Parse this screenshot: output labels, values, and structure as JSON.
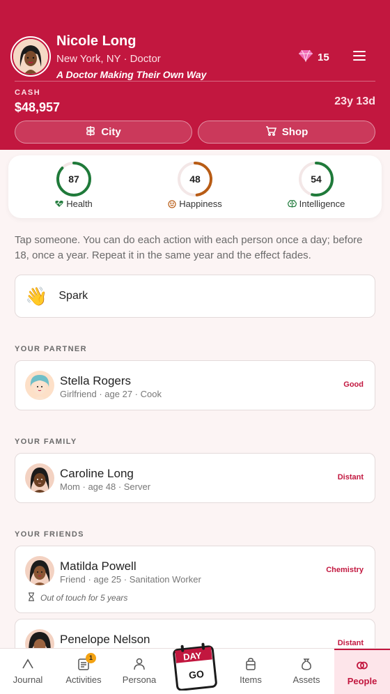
{
  "profile": {
    "name": "Nicole Long",
    "location": "New York, NY · Doctor",
    "tagline": "A Doctor Making Their Own Way",
    "gems": "15",
    "cash_label": "CASH",
    "cash": "$48,957",
    "age": "23y 13d"
  },
  "header_buttons": {
    "city": "City",
    "shop": "Shop"
  },
  "stats": [
    {
      "value": "87",
      "label": "Health",
      "icon": "heartbeat-icon",
      "color": "#1f7a3a"
    },
    {
      "value": "48",
      "label": "Happiness",
      "icon": "smile-icon",
      "color": "#b85c15"
    },
    {
      "value": "54",
      "label": "Intelligence",
      "icon": "brain-icon",
      "color": "#1f7a3a"
    }
  ],
  "instructions": "Tap someone. You can do each action with each person once a day; before 18, once a year. Repeat it in the same year and the effect fades.",
  "spark": {
    "emoji": "👋",
    "label": "Spark"
  },
  "sections": {
    "partner": "YOUR PARTNER",
    "family": "YOUR FAMILY",
    "friends": "YOUR FRIENDS"
  },
  "partner": {
    "name": "Stella Rogers",
    "desc": "Girlfriend · age 27 · Cook",
    "relation": "Good"
  },
  "family": [
    {
      "name": "Caroline Long",
      "desc": "Mom · age 48 · Server",
      "relation": "Distant"
    }
  ],
  "friends": [
    {
      "name": "Matilda Powell",
      "desc": "Friend · age 25 · Sanitation Worker",
      "relation": "Chemistry",
      "note": "Out of touch for 5 years"
    },
    {
      "name": "Penelope Nelson",
      "desc": "",
      "relation": "Distant"
    }
  ],
  "nav": {
    "journal": "Journal",
    "activities": "Activities",
    "activities_badge": "1",
    "persona": "Persona",
    "day": "DAY",
    "go": "GO",
    "items": "Items",
    "assets": "Assets",
    "people": "People"
  },
  "colors": {
    "brand": "#c2173f",
    "background": "#fcf4f4",
    "accent_green": "#1f7a3a",
    "accent_orange": "#b85c15"
  }
}
